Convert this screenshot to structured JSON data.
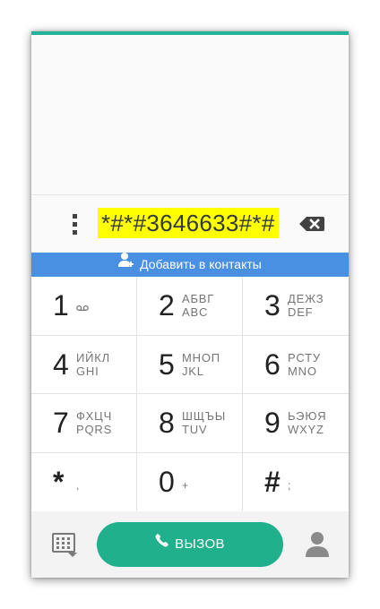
{
  "dialer": {
    "number": "*#*#3646633#*#",
    "more_icon": "more-vert-icon",
    "backspace_icon": "backspace-icon"
  },
  "add_contact": {
    "label": "Добавить в контакты",
    "icon": "add-person-icon"
  },
  "keys": [
    {
      "digit": "1",
      "letters": "",
      "alt": "",
      "voicemail": true
    },
    {
      "digit": "2",
      "letters": "АБВГ",
      "alt": "ABC"
    },
    {
      "digit": "3",
      "letters": "ДЕЖЗ",
      "alt": "DEF"
    },
    {
      "digit": "4",
      "letters": "ИЙКЛ",
      "alt": "GHI"
    },
    {
      "digit": "5",
      "letters": "МНОП",
      "alt": "JKL"
    },
    {
      "digit": "6",
      "letters": "РСТУ",
      "alt": "MNO"
    },
    {
      "digit": "7",
      "letters": "ФХЦЧ",
      "alt": "PQRS"
    },
    {
      "digit": "8",
      "letters": "ШЩЪЫ",
      "alt": "TUV"
    },
    {
      "digit": "9",
      "letters": "ЬЭЮЯ",
      "alt": "WXYZ"
    },
    {
      "digit": "*",
      "letters": "",
      "alt": ","
    },
    {
      "digit": "0",
      "letters": "",
      "alt": "+"
    },
    {
      "digit": "#",
      "letters": "",
      "alt": ";"
    }
  ],
  "bottom_bar": {
    "call_label": "ВЫЗОВ",
    "call_icon": "phone-icon",
    "keypad_icon": "dialpad-icon",
    "contacts_icon": "person-icon"
  },
  "colors": {
    "accent": "#24b39a",
    "call_button": "#20b08c",
    "banner": "#4a90e2",
    "highlight": "#ffff00"
  }
}
